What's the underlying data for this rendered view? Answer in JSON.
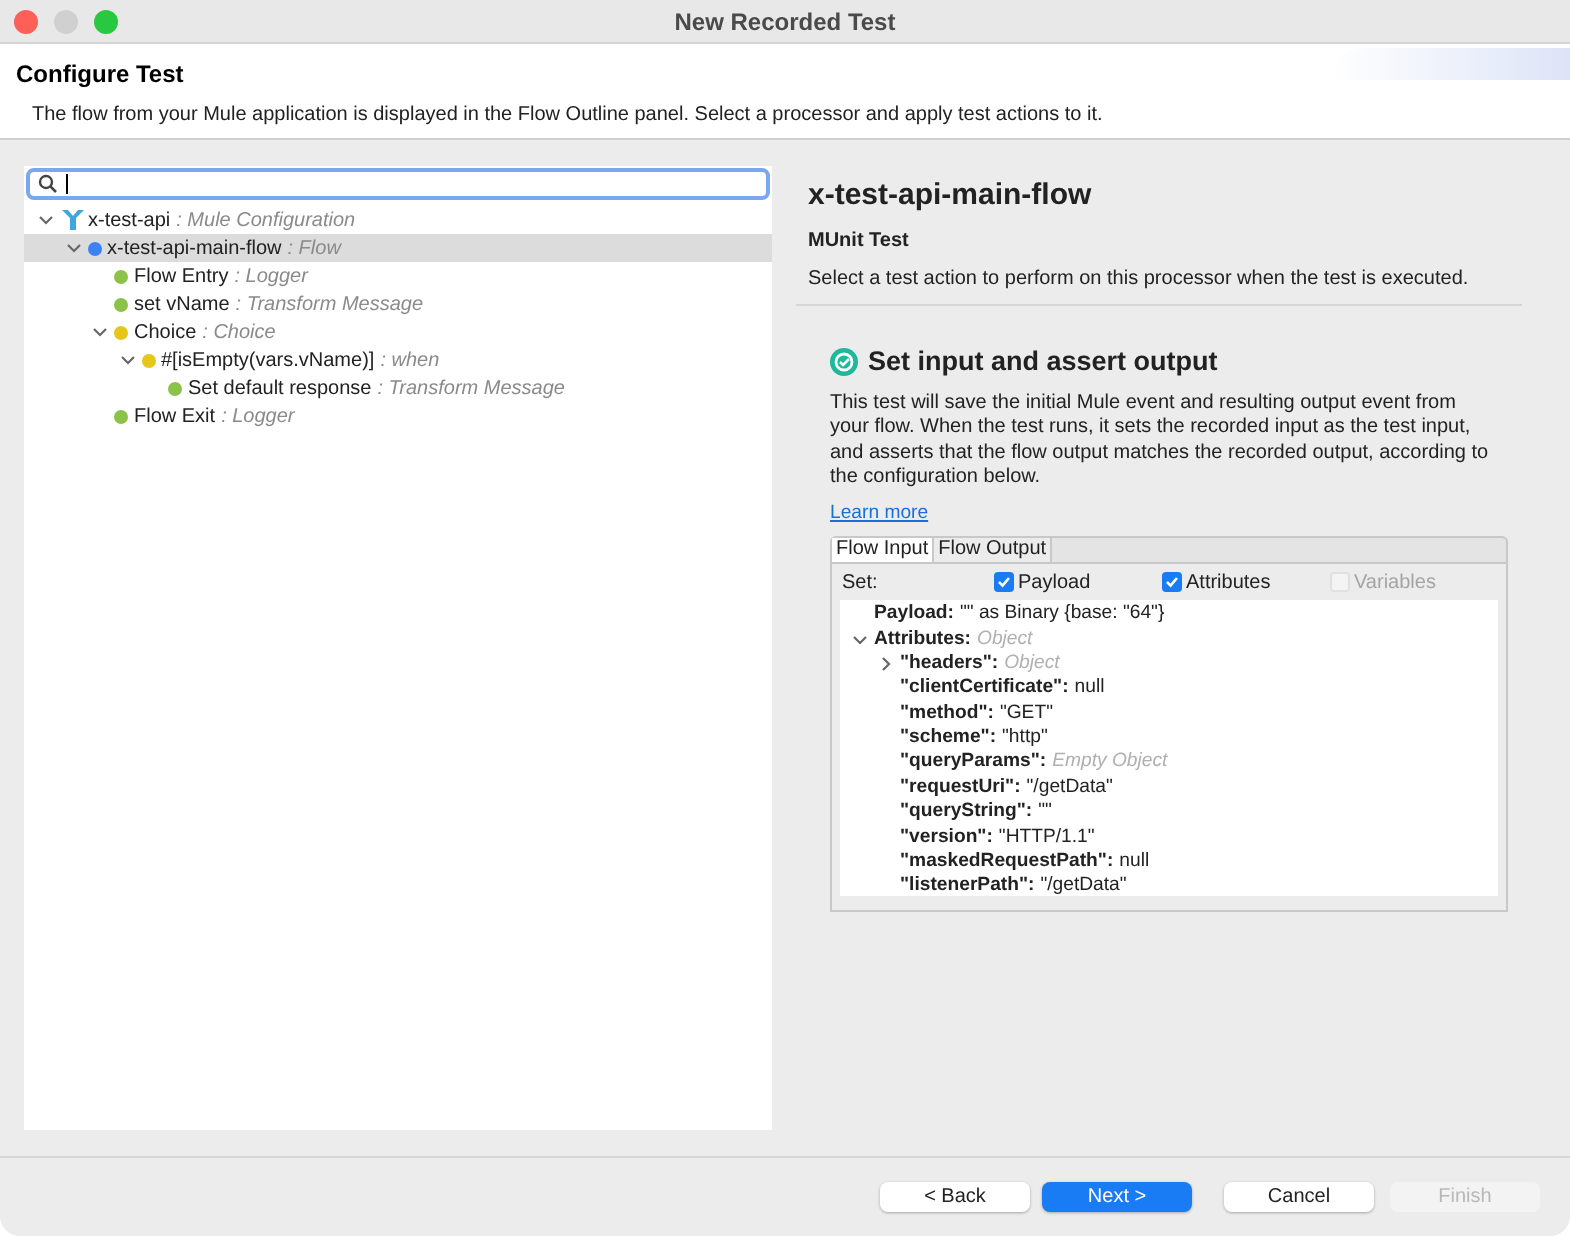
{
  "window": {
    "title": "New Recorded Test"
  },
  "header": {
    "title": "Configure Test",
    "description": "The flow from your Mule application is displayed in the Flow Outline panel. Select a processor and apply test actions to it."
  },
  "flow_outline": {
    "tree": [
      {
        "name": "x-test-api",
        "type": ": Mule Configuration",
        "kind": "config",
        "expanded": true,
        "selected": false,
        "children": [
          {
            "name": "x-test-api-main-flow",
            "type": ": Flow",
            "kind": "dot",
            "color": "#3b82f6",
            "expanded": true,
            "selected": true,
            "children": [
              {
                "name": "Flow Entry",
                "type": ": Logger",
                "kind": "dot",
                "color": "#8bc34a",
                "selected": false
              },
              {
                "name": "set vName",
                "type": ": Transform Message",
                "kind": "dot",
                "color": "#8bc34a",
                "selected": false
              },
              {
                "name": "Choice",
                "type": ": Choice",
                "kind": "dot",
                "color": "#e6c619",
                "expanded": true,
                "selected": false,
                "children": [
                  {
                    "name": "#[isEmpty(vars.vName)]",
                    "type": ": when",
                    "kind": "dot",
                    "color": "#e6c619",
                    "expanded": true,
                    "selected": false,
                    "children": [
                      {
                        "name": "Set default response",
                        "type": ": Transform Message",
                        "kind": "dot",
                        "color": "#8bc34a",
                        "selected": false
                      }
                    ]
                  }
                ]
              },
              {
                "name": "Flow Exit",
                "type": ": Logger",
                "kind": "dot",
                "color": "#8bc34a",
                "selected": false
              }
            ]
          }
        ]
      }
    ]
  },
  "details": {
    "title": "x-test-api-main-flow",
    "subtitle": "MUnit Test",
    "description": "Select a test action to perform on this processor when the test is executed.",
    "action": {
      "title": "Set input and assert output",
      "description": "This test will save the initial Mule event and resulting output event from your flow. When the test runs, it sets the recorded input as the test input, and asserts that the flow output matches the recorded output, according to the configuration below.",
      "link": "Learn more"
    },
    "tabs": [
      {
        "label": "Flow Input",
        "selected": true
      },
      {
        "label": "Flow Output",
        "selected": false
      }
    ],
    "set_label": "Set:",
    "checkboxes": [
      {
        "label": "Payload",
        "checked": true,
        "disabled": false
      },
      {
        "label": "Attributes",
        "checked": true,
        "disabled": false
      },
      {
        "label": "Variables",
        "checked": false,
        "disabled": true
      }
    ],
    "values": [
      {
        "key": "Payload:",
        "value": "\"\" as Binary {base: \"64\"}",
        "kind": "literal"
      },
      {
        "key": "Attributes:",
        "value": "Object",
        "kind": "type",
        "expanded": true,
        "children": [
          {
            "key": "\"headers\":",
            "value": "Object",
            "kind": "type",
            "expanded": false
          },
          {
            "key": "\"clientCertificate\":",
            "value": "null",
            "kind": "literal"
          },
          {
            "key": "\"method\":",
            "value": "\"GET\"",
            "kind": "literal"
          },
          {
            "key": "\"scheme\":",
            "value": "\"http\"",
            "kind": "literal"
          },
          {
            "key": "\"queryParams\":",
            "value": "Empty Object",
            "kind": "type"
          },
          {
            "key": "\"requestUri\":",
            "value": "\"/getData\"",
            "kind": "literal"
          },
          {
            "key": "\"queryString\":",
            "value": "\"\"",
            "kind": "literal"
          },
          {
            "key": "\"version\":",
            "value": "\"HTTP/1.1\"",
            "kind": "literal"
          },
          {
            "key": "\"maskedRequestPath\":",
            "value": "null",
            "kind": "literal"
          },
          {
            "key": "\"listenerPath\":",
            "value": "\"/getData\"",
            "kind": "literal"
          }
        ]
      }
    ]
  },
  "buttons": [
    {
      "label": "< Back",
      "kind": "default",
      "disabled": false
    },
    {
      "label": "Next >",
      "kind": "primary",
      "disabled": false
    },
    {
      "label": "Cancel",
      "kind": "default",
      "disabled": false
    },
    {
      "label": "Finish",
      "kind": "default",
      "disabled": true
    }
  ]
}
